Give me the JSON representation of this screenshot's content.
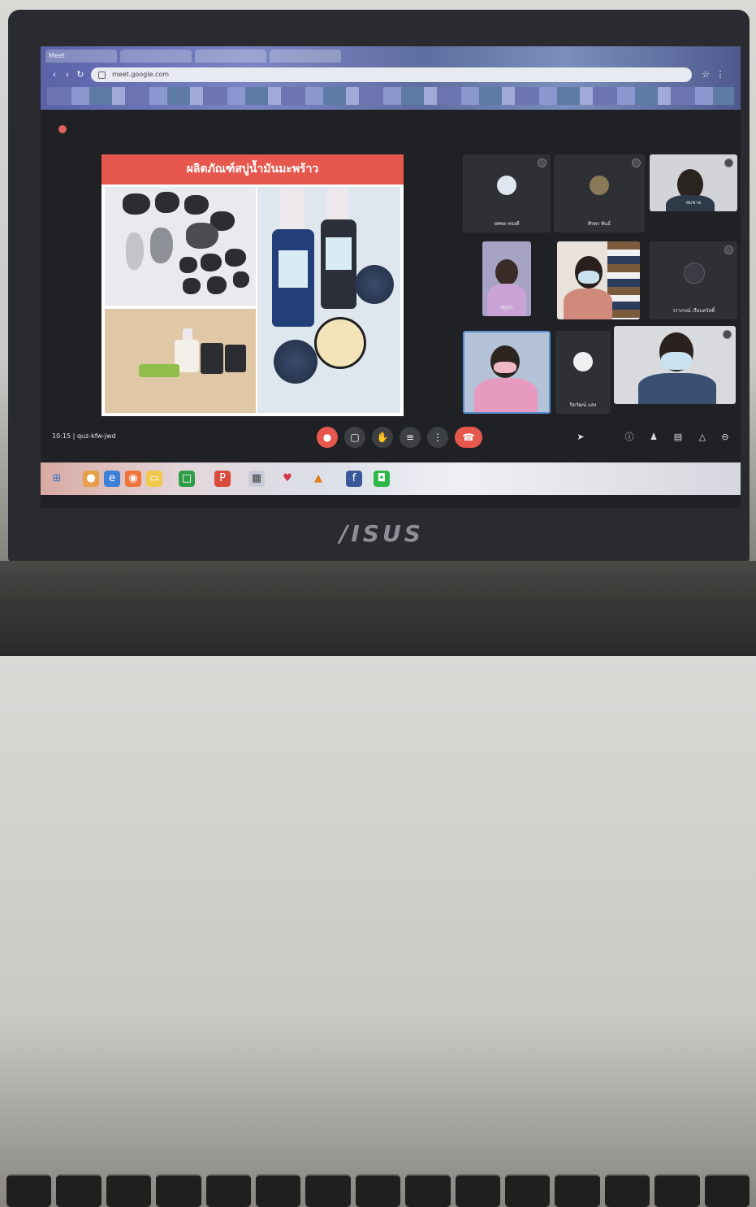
{
  "browser": {
    "tabs": [
      "Meet",
      "",
      "",
      ""
    ],
    "address": "meet.google.com"
  },
  "meeting": {
    "title": "",
    "slide": {
      "title": "ผลิตภัณฑ์สบู่น้ำมันมะพร้าว"
    },
    "time": "10:15  |  quz-kfw-jwd",
    "participants": [
      {
        "name": "ยศพล ทองดี",
        "video": false
      },
      {
        "name": "ศิรพร พันธ์",
        "video": false
      },
      {
        "name": "สมชาย",
        "video": true
      },
      {
        "name": "ณัฐพร",
        "video": true
      },
      {
        "name": "",
        "video": true
      },
      {
        "name": "วราภรณ์ เรือนสวัสดิ์",
        "video": false
      },
      {
        "name": "",
        "video": true
      },
      {
        "name": "ปิยวัฒน์ แสง",
        "video": false
      },
      {
        "name": "",
        "video": true
      }
    ],
    "controls": [
      "mic",
      "camera",
      "hand",
      "cc",
      "present",
      "end-call"
    ],
    "right_controls": [
      "info",
      "people",
      "chat",
      "activities",
      "security"
    ]
  },
  "laptop": {
    "brand": "/ISUS"
  },
  "taskbar": {
    "apps": [
      "windows",
      "chrome",
      "edge",
      "firefox",
      "line",
      "ppt",
      "files",
      "maps",
      "vlc",
      "facebook",
      "line2"
    ]
  },
  "colors": {
    "accent_red": "#e6584e",
    "meet_bg": "#202124"
  }
}
